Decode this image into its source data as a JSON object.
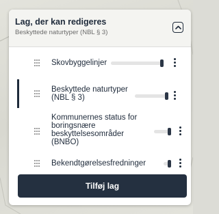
{
  "panel": {
    "title": "Lag, der kan redigeres",
    "subtitle": "Beskyttede naturtyper (NBL § 3)",
    "collapse_icon": "chevron-up-icon"
  },
  "layers": [
    {
      "label": "Skovbyggelinjer",
      "opacity": 1.0,
      "active": false
    },
    {
      "label": "Beskyttede naturtyper (NBL § 3)",
      "opacity": 1.0,
      "active": true
    },
    {
      "label": "Kommunernes status for boringsnære beskyttelsesområder (BNBO)",
      "opacity": 1.0,
      "active": false
    },
    {
      "label": "Bekendtgørelsesfredninger",
      "opacity": 1.0,
      "active": false
    }
  ],
  "add_button_label": "Tilføj lag",
  "colors": {
    "accent": "#243040",
    "header_bg": "#f4f4f1"
  }
}
